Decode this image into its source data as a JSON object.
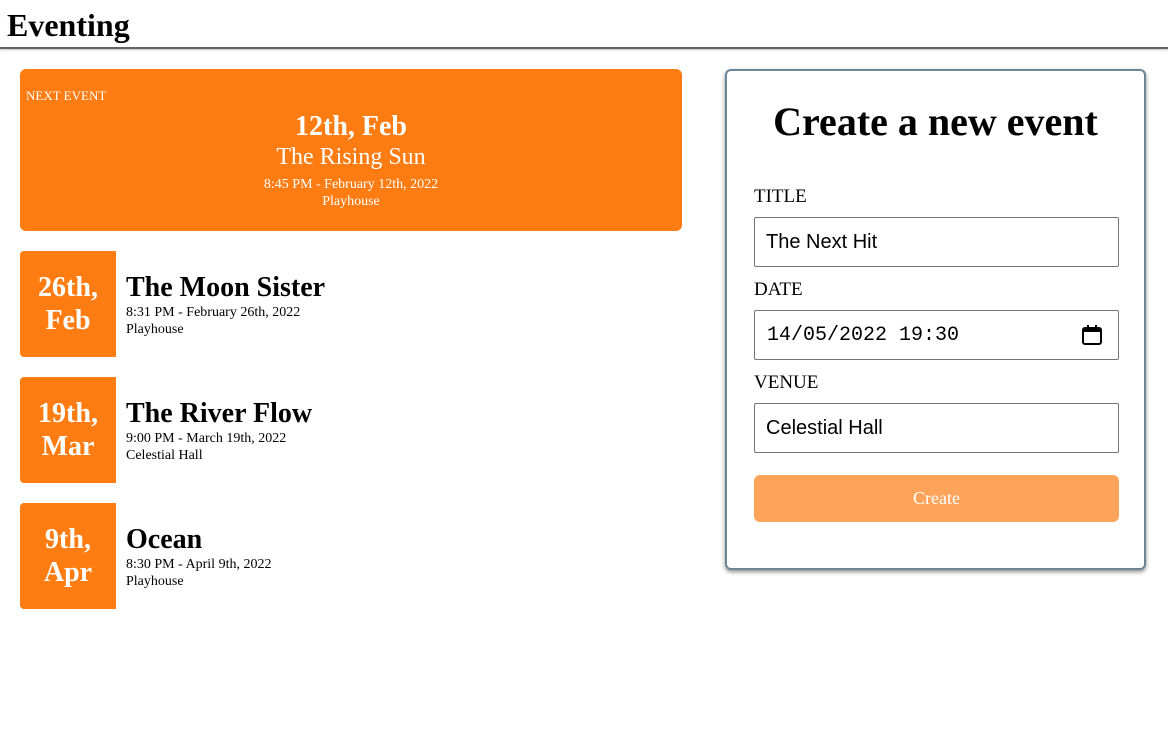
{
  "app": {
    "title": "Eventing"
  },
  "next_event": {
    "label": "NEXT EVENT",
    "date": "12th, Feb",
    "title": "The Rising Sun",
    "time": "8:45 PM - February 12th, 2022",
    "venue": "Playhouse"
  },
  "events": [
    {
      "day": "26th,",
      "month": "Feb",
      "title": "The Moon Sister",
      "time": "8:31 PM - February 26th, 2022",
      "venue": "Playhouse"
    },
    {
      "day": "19th,",
      "month": "Mar",
      "title": "The River Flow",
      "time": "9:00 PM - March 19th, 2022",
      "venue": "Celestial Hall"
    },
    {
      "day": "9th,",
      "month": "Apr",
      "title": "Ocean",
      "time": "8:30 PM - April 9th, 2022",
      "venue": "Playhouse"
    }
  ],
  "form": {
    "heading": "Create a new event",
    "title_label": "TITLE",
    "title_value": "The Next Hit",
    "date_label": "DATE",
    "date_value": "14/05/2022 19:30",
    "venue_label": "VENUE",
    "venue_value": "Celestial Hall",
    "submit_label": "Create"
  },
  "colors": {
    "accent": "#fe7c12",
    "accent_disabled": "#fea45a",
    "card_border": "#6d8695"
  },
  "icons": {
    "date_picker": "calendar-icon"
  }
}
